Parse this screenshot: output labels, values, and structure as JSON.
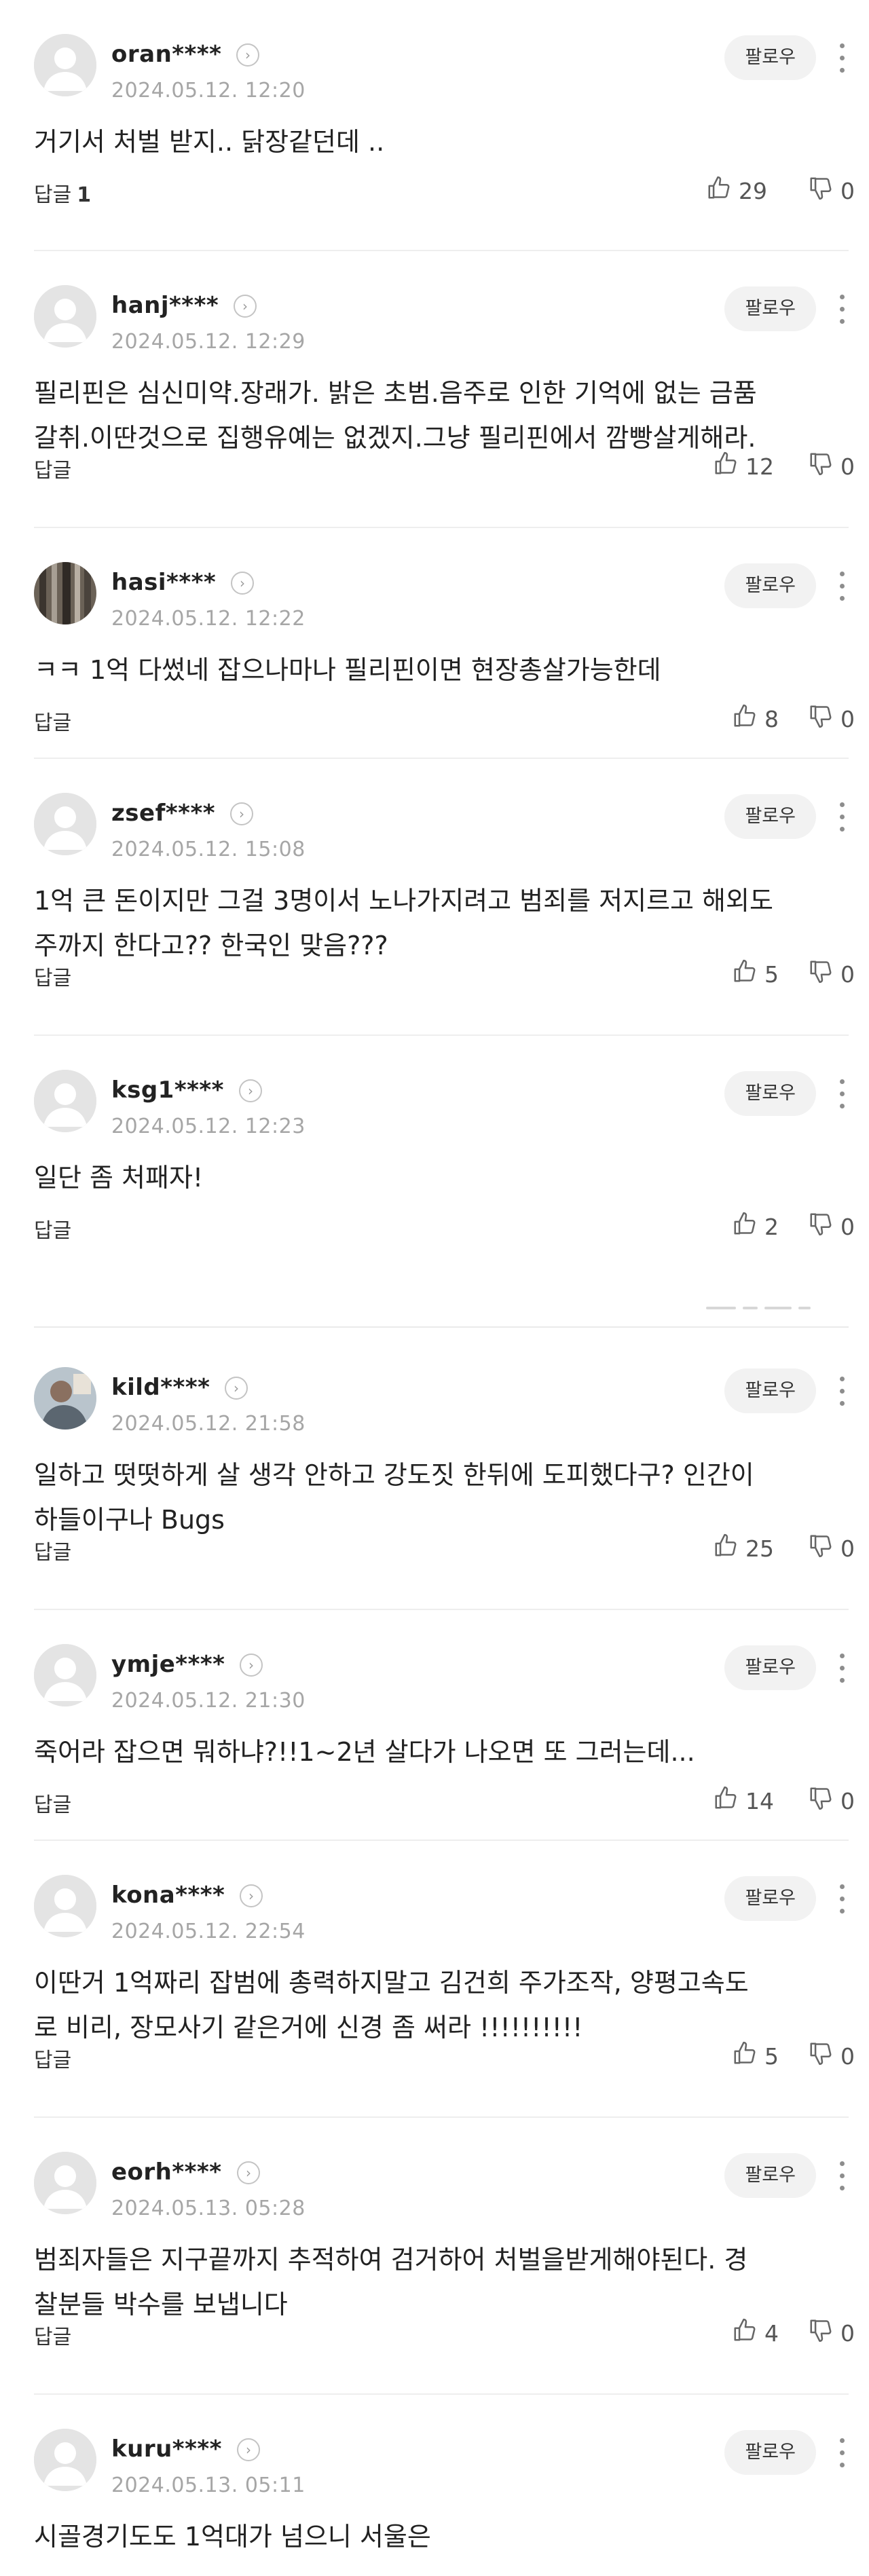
{
  "ui": {
    "follow_label": "팔로우",
    "reply_label": "답글"
  },
  "comments": [
    {
      "nick": "oran****",
      "date": "2024.05.12. 12:20",
      "text": "거기서 처벌 받지.. 닭장같던데 ..",
      "reply_count": "1",
      "likes": "29",
      "dislikes": "0",
      "avatar": "default-avatar-icon"
    },
    {
      "nick": "hanj****",
      "date": "2024.05.12. 12:29",
      "text": "필리핀은 심신미약.장래가. 밝은 초범.음주로 인한 기억에 없는 금품\n갈취.이딴것으로 집행유예는 없겠지.그냥 필리핀에서 깜빵살게해라.",
      "reply_count": "",
      "likes": "12",
      "dislikes": "0",
      "avatar": "default-avatar-icon"
    },
    {
      "nick": "hasi****",
      "date": "2024.05.12. 12:22",
      "text": "ㅋㅋ 1억 다썼네 잡으나마나 필리핀이면 현장총살가능한데",
      "reply_count": "",
      "likes": "8",
      "dislikes": "0",
      "avatar": "photo-avatar-icon"
    },
    {
      "nick": "zsef****",
      "date": "2024.05.12. 15:08",
      "text": "1억 큰 돈이지만 그걸 3명이서 노나가지려고 범죄를 저지르고 해외도\n주까지 한다고?? 한국인 맞음???",
      "reply_count": "",
      "likes": "5",
      "dislikes": "0",
      "avatar": "default-avatar-icon"
    },
    {
      "nick": "ksg1****",
      "date": "2024.05.12. 12:23",
      "text": "일단 좀 처패자!",
      "reply_count": "",
      "likes": "2",
      "dislikes": "0",
      "avatar": "default-avatar-icon"
    },
    {
      "nick": "kild****",
      "date": "2024.05.12. 21:58",
      "text": "일하고 떳떳하게 살 생각 안하고 강도짓 한뒤에 도피했다구? 인간이\n하들이구나 Bugs",
      "reply_count": "",
      "likes": "25",
      "dislikes": "0",
      "avatar": "photo-avatar-icon"
    },
    {
      "nick": "ymje****",
      "date": "2024.05.12. 21:30",
      "text": "죽어라 잡으면 뭐하냐?!!1~2년 살다가 나오면 또 그러는데...",
      "reply_count": "",
      "likes": "14",
      "dislikes": "0",
      "avatar": "default-avatar-icon"
    },
    {
      "nick": "kona****",
      "date": "2024.05.12. 22:54",
      "text": "이딴거 1억짜리 잡범에 총력하지말고 김건희 주가조작, 양평고속도\n로 비리, 장모사기 같은거에 신경 좀 써라 !!!!!!!!!!",
      "reply_count": "",
      "likes": "5",
      "dislikes": "0",
      "avatar": "default-avatar-icon"
    },
    {
      "nick": "eorh****",
      "date": "2024.05.13. 05:28",
      "text": "범죄자들은 지구끝까지 추적하여 검거하어 처벌을받게해야된다. 경\n찰분들 박수를 보냅니다",
      "reply_count": "",
      "likes": "4",
      "dislikes": "0",
      "avatar": "default-avatar-icon"
    },
    {
      "nick": "kuru****",
      "date": "2024.05.13. 05:11",
      "text": "시골경기도도 1억대가 넘으니 서울은",
      "reply_count": "",
      "likes": "",
      "dislikes": "",
      "avatar": "default-avatar-icon"
    }
  ]
}
